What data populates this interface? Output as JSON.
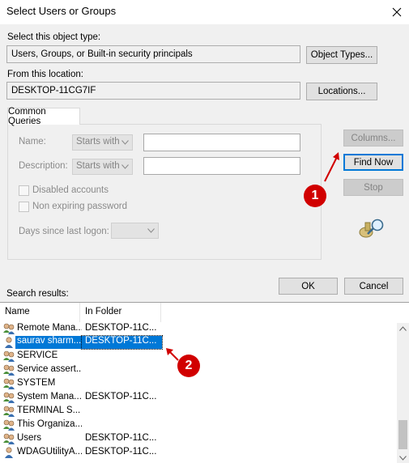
{
  "window": {
    "title": "Select Users or Groups"
  },
  "object_type": {
    "label": "Select this object type:",
    "value": "Users, Groups, or Built-in security principals",
    "button": "Object Types..."
  },
  "location": {
    "label": "From this location:",
    "value": "DESKTOP-11CG7IF",
    "button": "Locations..."
  },
  "common_queries": {
    "tab_label": "Common Queries",
    "name_label": "Name:",
    "name_mode": "Starts with",
    "name_value": "",
    "description_label": "Description:",
    "description_mode": "Starts with",
    "description_value": "",
    "disabled_accounts_label": "Disabled accounts",
    "non_expiring_label": "Non expiring password",
    "days_label": "Days since last logon:",
    "days_value": ""
  },
  "side_buttons": {
    "columns": "Columns...",
    "find_now": "Find Now",
    "stop": "Stop"
  },
  "dialog_buttons": {
    "ok": "OK",
    "cancel": "Cancel"
  },
  "results": {
    "label": "Search results:",
    "columns": [
      "Name",
      "In Folder"
    ],
    "rows": [
      {
        "name": "Remote Mana...",
        "folder": "DESKTOP-11C...",
        "icon": "group-icon"
      },
      {
        "name": "saurav sharm...",
        "folder": "DESKTOP-11C...",
        "icon": "user-icon",
        "selected": true
      },
      {
        "name": "SERVICE",
        "folder": "",
        "icon": "group-icon"
      },
      {
        "name": "Service assert...",
        "folder": "",
        "icon": "group-icon"
      },
      {
        "name": "SYSTEM",
        "folder": "",
        "icon": "group-icon"
      },
      {
        "name": "System Mana...",
        "folder": "DESKTOP-11C...",
        "icon": "group-icon"
      },
      {
        "name": "TERMINAL S...",
        "folder": "",
        "icon": "group-icon"
      },
      {
        "name": "This Organiza...",
        "folder": "",
        "icon": "group-icon"
      },
      {
        "name": "Users",
        "folder": "DESKTOP-11C...",
        "icon": "group-icon"
      },
      {
        "name": "WDAGUtilityA...",
        "folder": "DESKTOP-11C...",
        "icon": "user-icon"
      }
    ]
  },
  "annotations": {
    "marker_1": "1",
    "marker_2": "2"
  },
  "colors": {
    "accent": "#0078d7",
    "marker": "#d10000",
    "selection": "#0078d7"
  }
}
